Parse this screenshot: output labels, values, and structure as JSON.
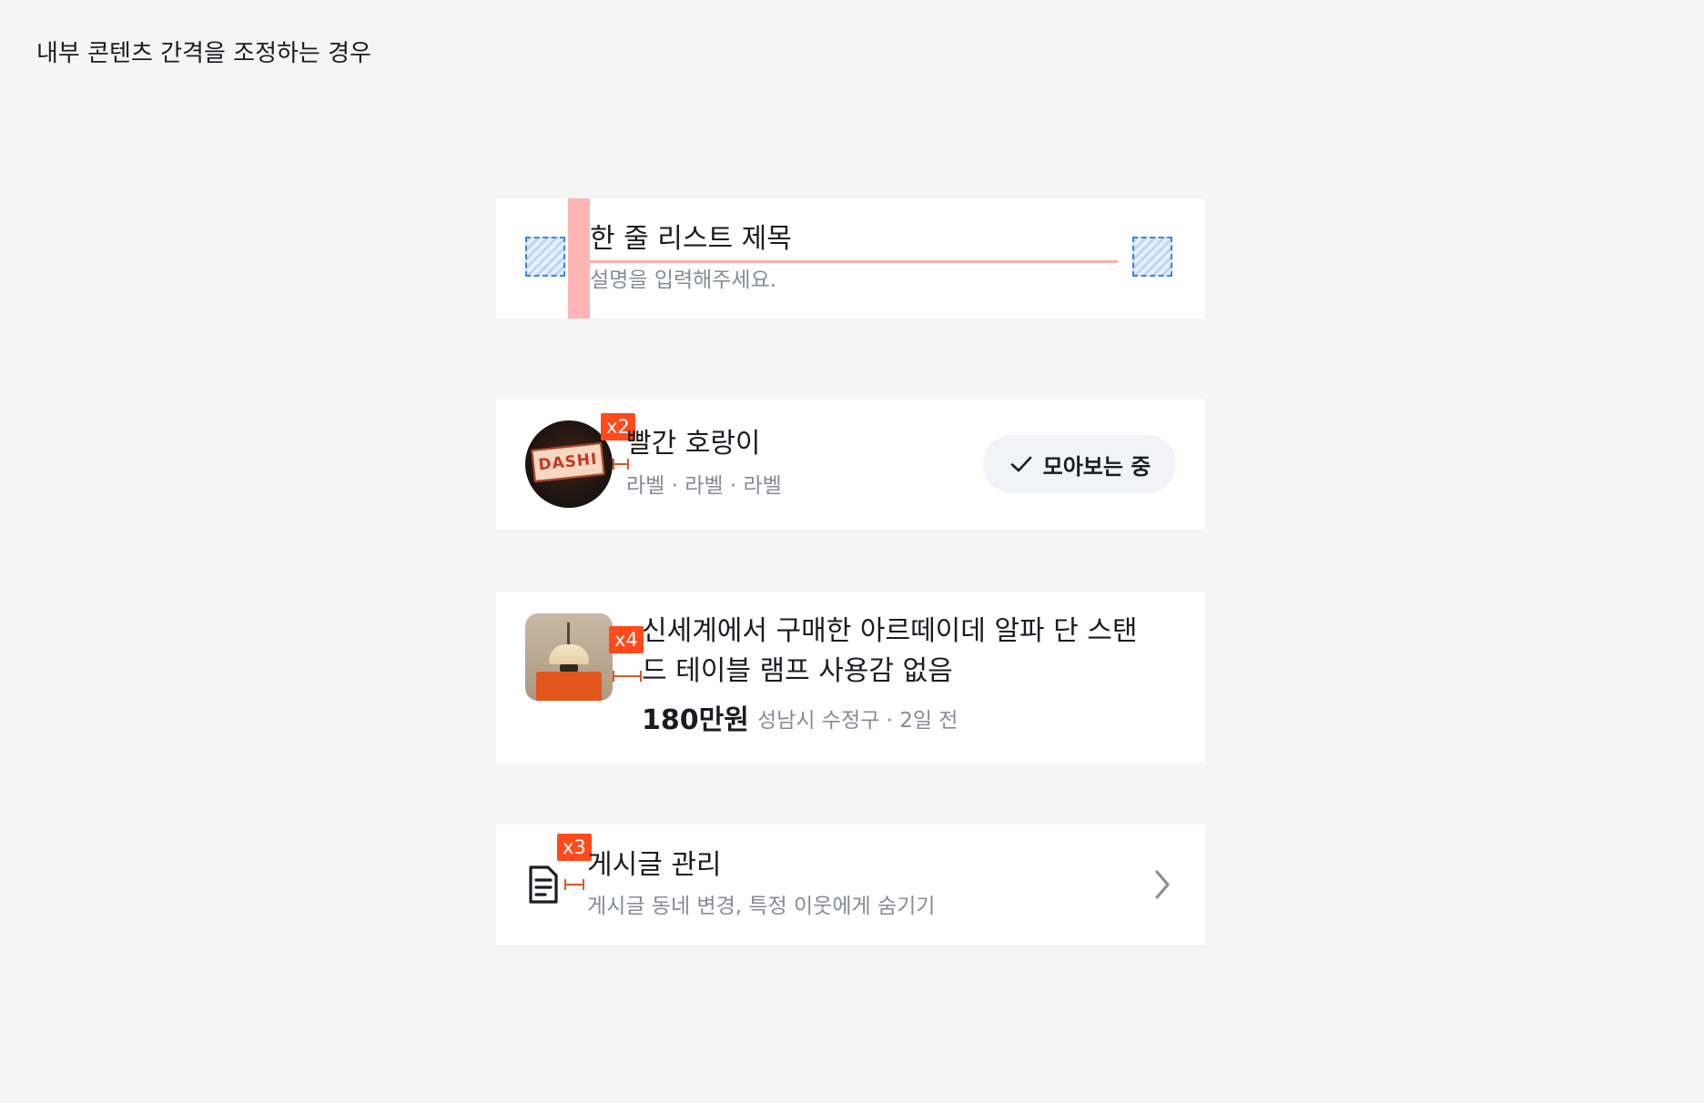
{
  "page": {
    "title": "내부 콘텐츠 간격을 조정하는 경우"
  },
  "card1": {
    "title": "한 줄 리스트 제목",
    "description": "설명을 입력해주세요."
  },
  "card2": {
    "avatar_sign": "DASHI",
    "gap_badge": "x2",
    "title": "빨간 호랑이",
    "labels": "라벨 · 라벨 · 라벨",
    "button_label": "모아보는 중",
    "button_icon": "check-icon"
  },
  "card3": {
    "gap_badge": "x4",
    "title_line1": "신세계에서 구매한 아르떼이데 알파 단 스탠",
    "title_line2": "드 테이블 램프 사용감 없음",
    "price": "180만원",
    "meta": "성남시 수정구 · 2일 전"
  },
  "card4": {
    "gap_badge": "x3",
    "title": "게시글 관리",
    "description": "게시글 동네 변경, 특정 이웃에게 숨기기",
    "leading_icon": "document-icon",
    "trailing_icon": "chevron-right-icon"
  },
  "colors": {
    "background": "#f5f5f5",
    "card": "#ffffff",
    "badge": "#ff4a1c",
    "spacing_marker": "#ffb3b3",
    "padding_marker": "#3b82f6",
    "secondary_text": "#868b94"
  }
}
